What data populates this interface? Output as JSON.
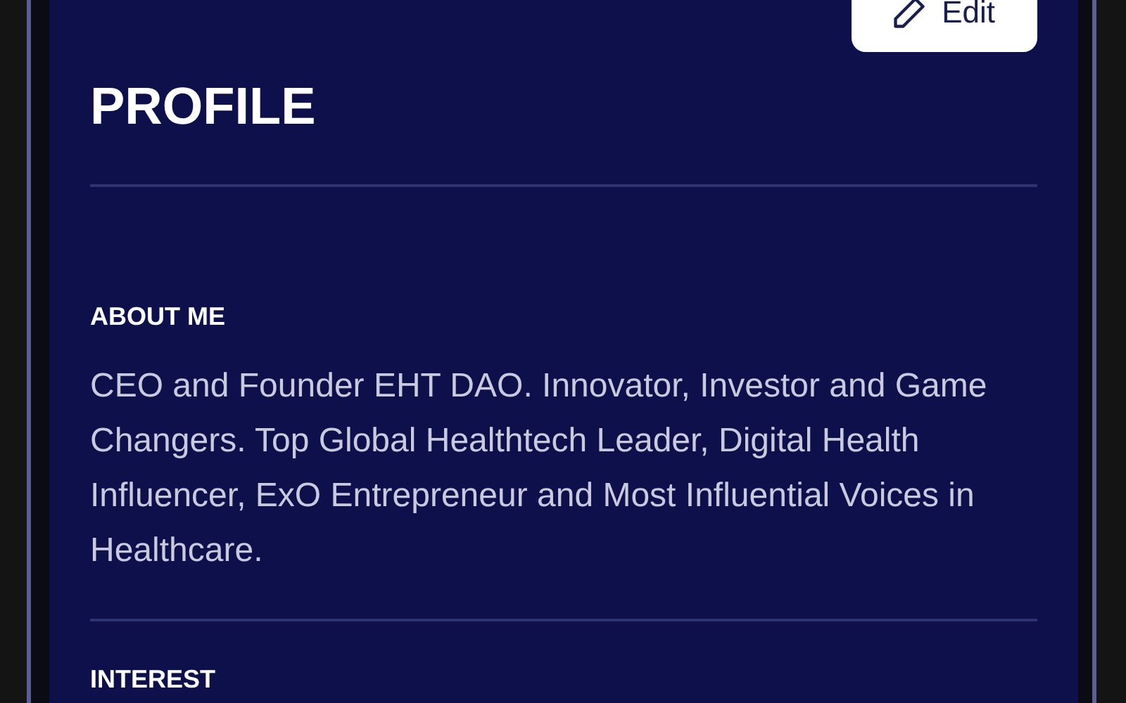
{
  "edit_button": {
    "label": "Edit"
  },
  "title": "PROFILE",
  "sections": [
    {
      "heading": "ABOUT ME",
      "text": "CEO and Founder EHT DAO. Innovator, Investor and Game Changers. Top Global Healthtech Leader, Digital Health Influencer, ExO Entrepreneur and Most Influential Voices in Healthcare."
    },
    {
      "heading": "INTEREST"
    }
  ]
}
